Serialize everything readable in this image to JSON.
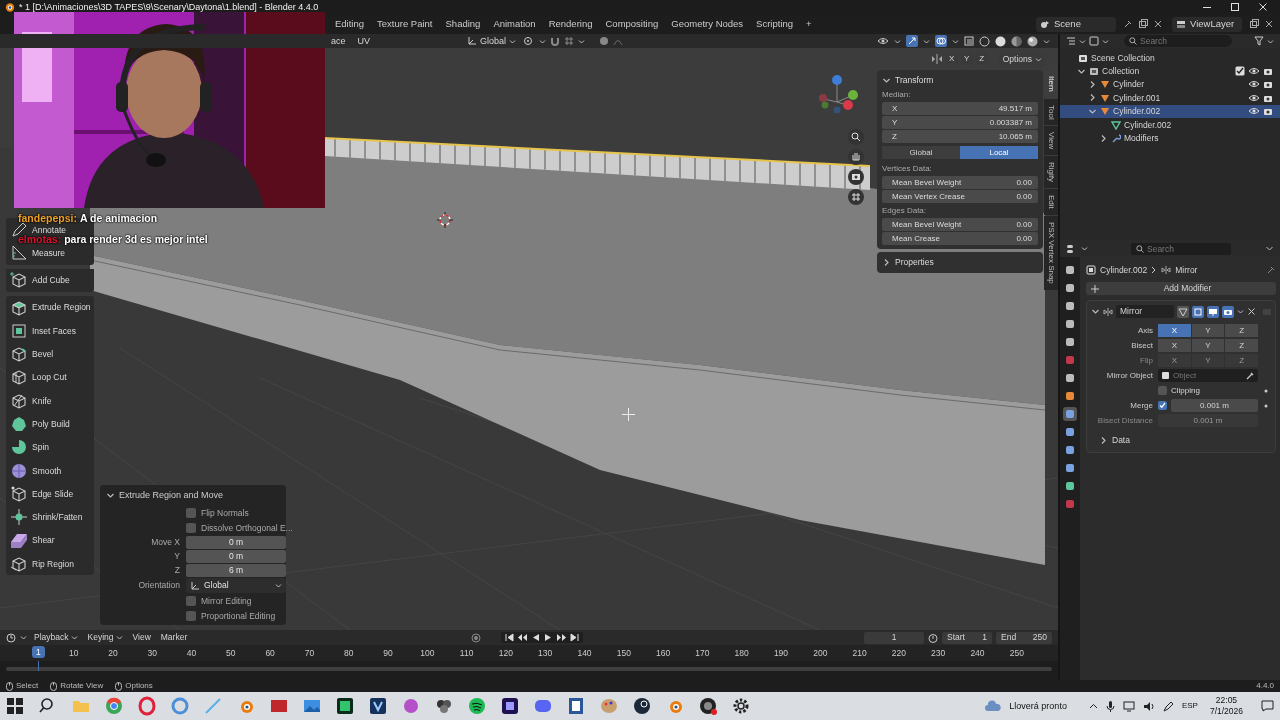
{
  "window": {
    "title": "* 1 [D:\\Animaciones\\3D TAPES\\9\\Scenary\\Daytona\\1.blend] - Blender 4.4.0"
  },
  "workspaces": {
    "tabs": [
      {
        "label": "Editing",
        "selected": false
      },
      {
        "label": "Texture Paint",
        "selected": false
      },
      {
        "label": "Shading",
        "selected": false
      },
      {
        "label": "Animation",
        "selected": false
      },
      {
        "label": "Rendering",
        "selected": false
      },
      {
        "label": "Compositing",
        "selected": false
      },
      {
        "label": "Geometry Nodes",
        "selected": false
      },
      {
        "label": "Scripting",
        "selected": false
      }
    ],
    "add": "+"
  },
  "scene": "Scene",
  "view_layer": "ViewLayer",
  "viewport": {
    "header": {
      "mode_tail": "ace",
      "uv_menu": "UV",
      "orientation": "Global",
      "axes": [
        "X",
        "Y",
        "Z"
      ],
      "options": "Options"
    },
    "chat": [
      {
        "user": "fandepepsi:",
        "message": "A de animacion",
        "color": "#f0a028"
      },
      {
        "user": "elmotas:",
        "message": "para render 3d es mejor intel",
        "color": "#d8142c"
      }
    ],
    "toolbar": [
      {
        "tools": [
          {
            "label": "Annotate"
          },
          {
            "label": "Measure"
          }
        ]
      },
      {
        "tools": [
          {
            "label": "Add Cube"
          }
        ]
      },
      {
        "tools": [
          {
            "label": "Extrude Region"
          },
          {
            "label": "Inset Faces"
          },
          {
            "label": "Bevel"
          },
          {
            "label": "Loop Cut"
          },
          {
            "label": "Knife"
          },
          {
            "label": "Poly Build"
          },
          {
            "label": "Spin"
          },
          {
            "label": "Smooth"
          },
          {
            "label": "Edge Slide"
          },
          {
            "label": "Shrink/Fatten"
          },
          {
            "label": "Shear"
          },
          {
            "label": "Rip Region"
          }
        ]
      }
    ],
    "operator_panel": {
      "title": "Extrude Region and Move",
      "expanded": true,
      "rows": [
        {
          "kind": "checkbox",
          "label": "Flip Normals",
          "checked": false
        },
        {
          "kind": "checkbox",
          "label": "Dissolve Orthogonal E...",
          "checked": false
        },
        {
          "kind": "number",
          "label": "Move X",
          "value": "0 m"
        },
        {
          "kind": "number",
          "label": "Y",
          "value": "0 m"
        },
        {
          "kind": "number",
          "label": "Z",
          "value": "6 m"
        },
        {
          "kind": "dropdown",
          "label": "Orientation",
          "value": "Global"
        },
        {
          "kind": "checkbox",
          "label": "Mirror Editing",
          "checked": false
        },
        {
          "kind": "checkbox",
          "label": "Proportional Editing",
          "checked": false
        }
      ]
    }
  },
  "sidebar": {
    "transform": {
      "title": "Transform",
      "expanded": true,
      "median_label": "Median:",
      "median": [
        {
          "label": "X",
          "value": "49.517 m"
        },
        {
          "label": "Y",
          "value": "0.003387 m"
        },
        {
          "label": "Z",
          "value": "10.065 m"
        }
      ],
      "space": [
        {
          "label": "Global",
          "selected": false
        },
        {
          "label": "Local",
          "selected": true
        }
      ],
      "vertices_label": "Vertices Data:",
      "vertices": [
        {
          "label": "Mean Bevel Weight",
          "value": "0.00"
        },
        {
          "label": "Mean Vertex Crease",
          "value": "0.00"
        }
      ],
      "edges_label": "Edges Data:",
      "edges": [
        {
          "label": "Mean Bevel Weight",
          "value": "0.00"
        },
        {
          "label": "Mean Crease",
          "value": "0.00"
        }
      ]
    },
    "properties_panel": {
      "title": "Properties",
      "expanded": false
    },
    "tabs": [
      {
        "label": "Item",
        "selected": true
      },
      {
        "label": "Tool",
        "selected": false
      },
      {
        "label": "View",
        "selected": false
      },
      {
        "label": "Rigify",
        "selected": false
      },
      {
        "label": "Edit",
        "selected": false
      },
      {
        "label": "PSX Vertex Snap",
        "selected": false
      }
    ]
  },
  "outliner": {
    "search": {
      "placeholder": "Search"
    },
    "tree": [
      {
        "label": "Scene Collection",
        "kind": "scene",
        "selected": false,
        "children": [
          {
            "label": "Collection",
            "kind": "collection",
            "expanded": true,
            "checked": true,
            "selected": false,
            "children": [
              {
                "label": "Cylinder",
                "kind": "object",
                "expanded": false,
                "selected": false
              },
              {
                "label": "Cylinder.001",
                "kind": "object",
                "expanded": false,
                "selected": false
              },
              {
                "label": "Cylinder.002",
                "kind": "object",
                "expanded": true,
                "selected": true,
                "children": [
                  {
                    "label": "Cylinder.002",
                    "kind": "mesh",
                    "selected": false
                  },
                  {
                    "label": "Modifiers",
                    "kind": "modifiers",
                    "expanded": false,
                    "selected": false
                  }
                ]
              }
            ]
          }
        ]
      }
    ]
  },
  "properties": {
    "search": {
      "placeholder": "Search"
    },
    "tabs": [
      {
        "selected": false
      },
      {
        "selected": false
      },
      {
        "selected": false
      },
      {
        "selected": false
      },
      {
        "selected": false
      },
      {
        "selected": false
      },
      {
        "selected": false
      },
      {
        "selected": false
      },
      {
        "selected": true
      },
      {
        "selected": false
      },
      {
        "selected": false
      },
      {
        "selected": false
      },
      {
        "selected": false
      },
      {
        "selected": false
      }
    ],
    "breadcrumb": [
      "Cylinder.002",
      "Mirror"
    ],
    "add_modifier": "Add Modifier",
    "modifier": {
      "name": "Mirror",
      "expanded": true,
      "display_toggles": [
        {
          "on": false
        },
        {
          "on": true
        },
        {
          "on": true
        },
        {
          "on": true
        }
      ],
      "rows": [
        {
          "kind": "toggles",
          "label": "Axis",
          "disabled": false,
          "options": [
            {
              "label": "X",
              "selected": true
            },
            {
              "label": "Y",
              "selected": false
            },
            {
              "label": "Z",
              "selected": false
            }
          ]
        },
        {
          "kind": "toggles",
          "label": "Bisect",
          "disabled": false,
          "options": [
            {
              "label": "X",
              "selected": false
            },
            {
              "label": "Y",
              "selected": false
            },
            {
              "label": "Z",
              "selected": false
            }
          ]
        },
        {
          "kind": "toggles",
          "label": "Flip",
          "disabled": true,
          "options": [
            {
              "label": "X",
              "selected": false
            },
            {
              "label": "Y",
              "selected": false
            },
            {
              "label": "Z",
              "selected": false
            }
          ]
        },
        {
          "kind": "object",
          "label": "Mirror Object",
          "placeholder": "Object"
        },
        {
          "kind": "checkbox",
          "label": "Clipping",
          "checked": false
        },
        {
          "kind": "checked_number",
          "label": "Merge",
          "checked": true,
          "value": "0.001 m"
        },
        {
          "kind": "number",
          "label": "Bisect Distance",
          "value": "0.001 m",
          "disabled": true
        }
      ]
    },
    "data_panel": {
      "title": "Data",
      "expanded": false
    }
  },
  "timeline": {
    "menus": [
      {
        "label": "Playback",
        "kind": "dropdown"
      },
      {
        "label": "Keying",
        "kind": "dropdown"
      },
      {
        "label": "View",
        "kind": "menu"
      },
      {
        "label": "Marker",
        "kind": "menu"
      }
    ],
    "current_frame": "1",
    "start_label": "Start",
    "start": "1",
    "end_label": "End",
    "end": "250",
    "playhead": "1",
    "ruler": [
      "10",
      "20",
      "30",
      "40",
      "50",
      "60",
      "70",
      "80",
      "90",
      "100",
      "110",
      "120",
      "130",
      "140",
      "150",
      "160",
      "170",
      "180",
      "190",
      "200",
      "210",
      "220",
      "230",
      "240",
      "250"
    ]
  },
  "status_bar": {
    "hints": [
      "Select",
      "Rotate View",
      "Options"
    ],
    "version": "4.4.0"
  },
  "taskbar": {
    "weather": "Lloverá pronto",
    "language": "ESP",
    "time": "22:05",
    "date": "7/1/2026"
  }
}
